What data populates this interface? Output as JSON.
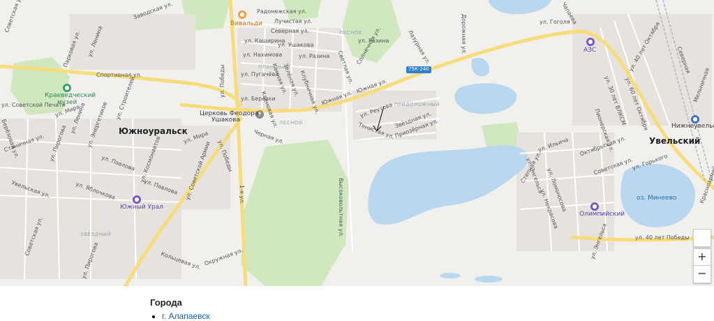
{
  "map": {
    "cities": {
      "yuzhnouralsk": "Южноуральск",
      "uvelsky": "Увельский"
    },
    "districts": {
      "lesnoe": "ЛЕСНОЕ",
      "planovy": "ПЛАНОВЫЙ",
      "lesnoy": "ЛЕСНОЙ",
      "prigorodny": "ПРИДОРОЖНЫЙ",
      "zvezdny": "ЗВЁЗДНЫЙ"
    },
    "pois": {
      "vivaldi": "Вивальди",
      "museum_line1": "Краеведческий",
      "museum_line2": "музей",
      "church_line1": "Церковь Феодора",
      "church_line2": "Ушакова",
      "azs": "АЗС",
      "yuzhny_ural": "Южный Урал",
      "olimpiysky": "Олимпийский",
      "nizhneuvelskaya": "Нижнеувельская",
      "lake_mineevo": "оз. Минеево"
    },
    "road_badge": "75К-240",
    "streets": {
      "zavodskaya": "Заводская ул.",
      "radonezhskaya": "Радонежская ул.",
      "luchistaya": "Лучистая ул.",
      "severnaya": "Северная ул.",
      "kashirina": "ул. Каширина",
      "ushakova": "ул. Ушакова",
      "nakhimova": "ул. Нахимова",
      "razina1": "ул. Разина",
      "razina2": "ул. Разина",
      "pugacheva": "ул. Пугачёва",
      "berezki": "ул. Берёзки",
      "klubnichnaya": "Клубничная ул.",
      "solnechnaya": "Солнечная ул.",
      "svetlaya": "Светлая ул.",
      "lazurnaya": "Лазурная ул.",
      "dorozhnaya": "Дорожная ул.",
      "gogolya": "ул. Гоголя",
      "chapaeva": "Чапаева",
      "yuzhnaya1": "Южная ул.",
      "yuzhnaya2": "Южная ул.",
      "reutova": "ул. Реутова",
      "tenistaya": "Тенистая ул.",
      "zvezdnaya": "Звёздная ул.",
      "prozernaya": "Приозёрная ул.",
      "pobedy1": "ул. Победы",
      "pobedy2": "ул. Победы",
      "kamnaya": "Камная ул.",
      "zelenaya": "Зелёная ул.",
      "chernaya": "Черная ул.",
      "klenovaya": "Кленовая ул.",
      "sovetskaya1": "Советская ул.",
      "sovetskaya2": "Советская ул.",
      "parkovaya": "Парковая ул.",
      "lenina1": "ул. Ленина",
      "lenina2": "ул. Ленина",
      "sportivnaya": "Спортивная ул.",
      "sovpechati": "ул. Советской Печати",
      "mira1": "ул. Мира",
      "mira2": "ул. Мира",
      "stroiteley": "ул. Строителей",
      "energetikov": "ул. Энергетиков",
      "berezovaya": "Берёзовая ул.",
      "stanichnaya": "Станичная ул.",
      "pirogova1": "ул. Пирогова",
      "pirogova2": "ул. Пирогова",
      "kosmonavtov": "ул. Космонавтов",
      "pavlova1": "ул. Павлова",
      "pavlova2": "ул. Павлова",
      "uvelskaya": "Увельская ул.",
      "yablochkova": "ул. Яблочкова",
      "sovarmii": "ул. Советской Армии",
      "kolcevaya": "Кольцевая ул.",
      "okruzhnaya": "Окружная ул.",
      "vysokovoltnaya": "Высоковольтная ул.",
      "first": "1-я ул.",
      "sovetskaya3": "Советская ул.",
      "gorkogo": "ул. Горького",
      "ilyicha": "ул. Ильича",
      "stepnaya": "Степная ул.",
      "engelsa1": "ул. Энгельса",
      "engelsa2": "ул. Энгельса",
      "lomonosova": "ул. Ломоносова",
      "nekrasova": "ул. Некрасова",
      "oktyabrskaya": "Октябрьская ул.",
      "pionerskaya": "Пионерская ул.",
      "vlksm": "ул. 30 лет ВЛКСМ",
      "oktyabrya1": "ул. 40 лет Октября",
      "oktyabrya2": "ул. 60 лет Октября",
      "pobedy40": "ул. 40 лет Победы",
      "krasnoarmeyskaya": "Красноармейская ул.",
      "melnichnaya": "Мельничная",
      "severnaya2": "Северная"
    },
    "zoom_in": "+",
    "zoom_out": "−"
  },
  "list": {
    "heading": "Города",
    "items": [
      "г. Алапаевск"
    ]
  }
}
